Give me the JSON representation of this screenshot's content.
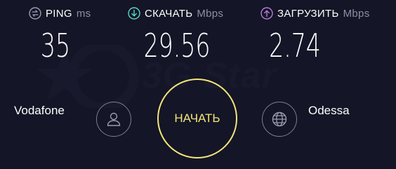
{
  "metrics": {
    "ping": {
      "name": "PING",
      "unit": "ms",
      "value": "35",
      "icon": "ping-icon",
      "color": "#9a9cb0"
    },
    "download": {
      "name": "СКАЧАТЬ",
      "unit": "Mbps",
      "value": "29.56",
      "icon": "download-arrow-icon",
      "color": "#56d6c8"
    },
    "upload": {
      "name": "ЗАГРУЗИТЬ",
      "unit": "Mbps",
      "value": "2.74",
      "icon": "upload-arrow-icon",
      "color": "#b57ad8"
    }
  },
  "isp": {
    "name": "Vodafone",
    "icon": "user-icon"
  },
  "server": {
    "name": "Odessa",
    "icon": "globe-icon"
  },
  "start_button": {
    "label": "НАЧАТЬ",
    "color": "#f2e57a"
  },
  "watermark": {
    "text": "3G Star"
  },
  "colors": {
    "background": "#141526",
    "text": "#ffffff",
    "muted": "#8d8fa6"
  }
}
